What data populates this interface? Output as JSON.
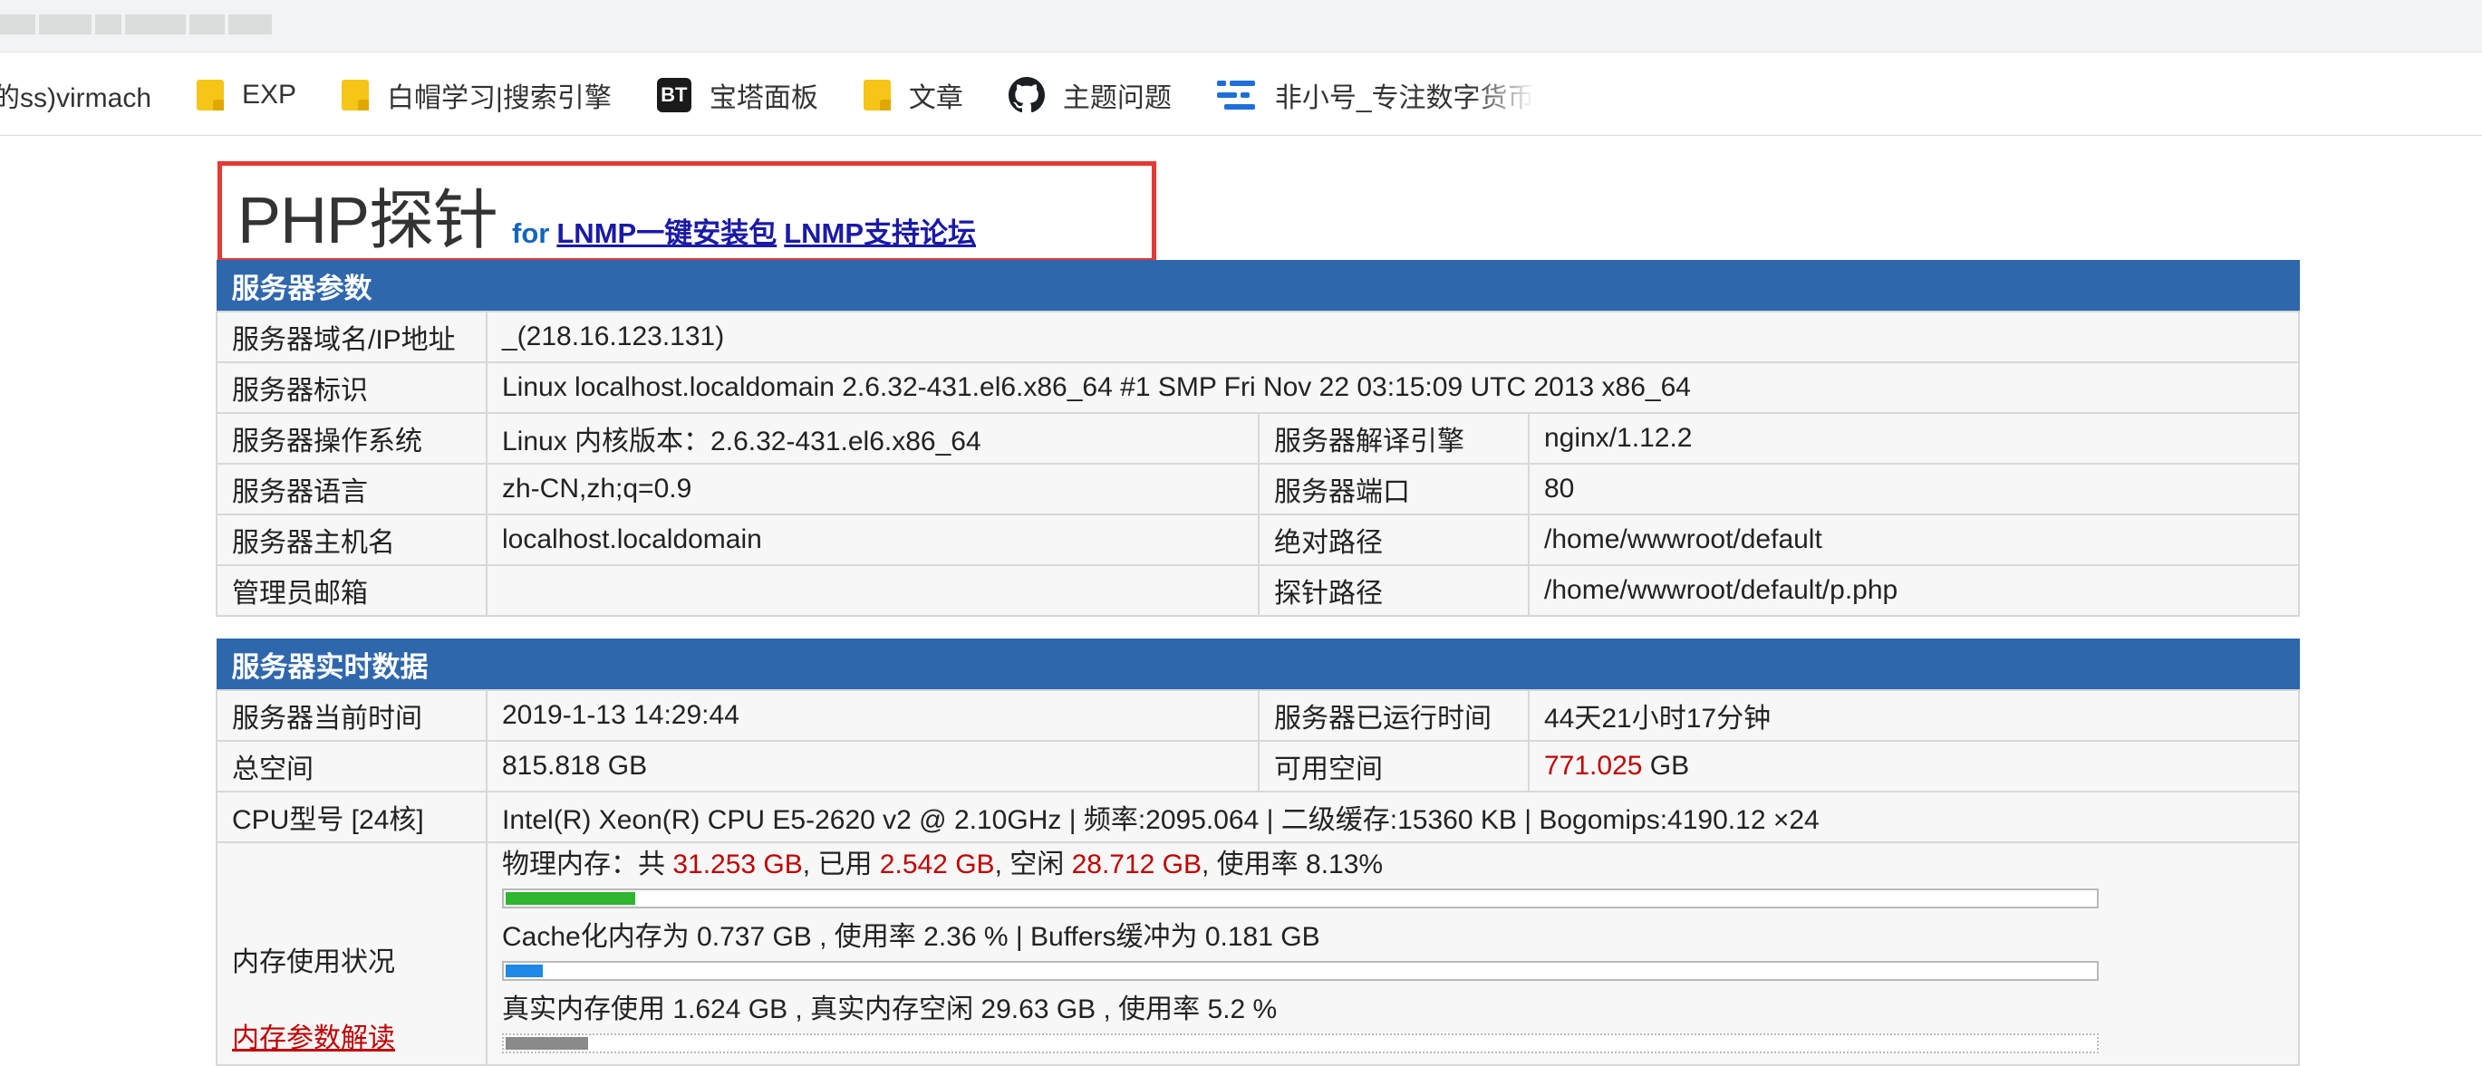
{
  "browser": {
    "bookmarks": [
      {
        "label": "的ss)virmach",
        "icon": "none"
      },
      {
        "label": "EXP",
        "icon": "folder-icon"
      },
      {
        "label": "白帽学习|搜索引擎",
        "icon": "folder-icon"
      },
      {
        "label": "宝塔面板",
        "icon": "bt-icon",
        "icon_text": "BT"
      },
      {
        "label": "文章",
        "icon": "folder-icon"
      },
      {
        "label": "主题问题",
        "icon": "github-icon"
      },
      {
        "label": "非小号_专注数字货币",
        "icon": "feixiaohao-icon"
      }
    ]
  },
  "header": {
    "title": "PHP探针",
    "for_text": "for",
    "link1": "LNMP一键安装包",
    "link2": "LNMP支持论坛"
  },
  "server_params": {
    "section_title": "服务器参数",
    "rows": {
      "domain_label": "服务器域名/IP地址",
      "domain_value": "_(218.16.123.131)",
      "ident_label": "服务器标识",
      "ident_value": "Linux localhost.localdomain 2.6.32-431.el6.x86_64 #1 SMP Fri Nov 22 03:15:09 UTC 2013 x86_64",
      "os_label": "服务器操作系统",
      "os_value": "Linux  内核版本：2.6.32-431.el6.x86_64",
      "engine_label": "服务器解译引擎",
      "engine_value": "nginx/1.12.2",
      "lang_label": "服务器语言",
      "lang_value": "zh-CN,zh;q=0.9",
      "port_label": "服务器端口",
      "port_value": "80",
      "host_label": "服务器主机名",
      "host_value": "localhost.localdomain",
      "abspath_label": "绝对路径",
      "abspath_value": "/home/wwwroot/default",
      "admin_label": "管理员邮箱",
      "admin_value": "",
      "probepath_label": "探针路径",
      "probepath_value": "/home/wwwroot/default/p.php"
    }
  },
  "realtime": {
    "section_title": "服务器实时数据",
    "time_label": "服务器当前时间",
    "time_value": "2019-1-13 14:29:44",
    "uptime_label": "服务器已运行时间",
    "uptime_value": "44天21小时17分钟",
    "total_label": "总空间",
    "total_value": "815.818 GB",
    "free_label": "可用空间",
    "free_value": "771.025",
    "free_unit": "GB",
    "cpu_label": "CPU型号 [24核]",
    "cpu_value": "Intel(R) Xeon(R) CPU E5-2620 v2 @ 2.10GHz | 频率:2095.064 | 二级缓存:15360 KB | Bogomips:4190.12 ×24",
    "mem_label": "内存使用状况",
    "mem_link": "内存参数解读",
    "mem": {
      "phys_prefix": "物理内存：共",
      "phys_total": "31.253 GB",
      "phys_used_prefix": ", 已用",
      "phys_used": "2.542 GB",
      "phys_free_prefix": ", 空闲",
      "phys_free": "28.712 GB",
      "phys_rate_text": ", 使用率 8.13%",
      "phys_rate": 8.13,
      "cache_text": "Cache化内存为 0.737 GB , 使用率 2.36 % | Buffers缓冲为 0.181 GB",
      "cache_rate": 2.36,
      "real_text": "真实内存使用 1.624 GB , 真实内存空闲 29.63 GB , 使用率 5.2 %",
      "real_rate": 5.2
    }
  },
  "colors": {
    "section_header": "#2f67ad",
    "highlight_red": "#c00000",
    "bar_green": "#2fb52f",
    "bar_blue": "#1e88e5",
    "bar_gray": "#8a8a8a",
    "box_red": "#e53935"
  }
}
